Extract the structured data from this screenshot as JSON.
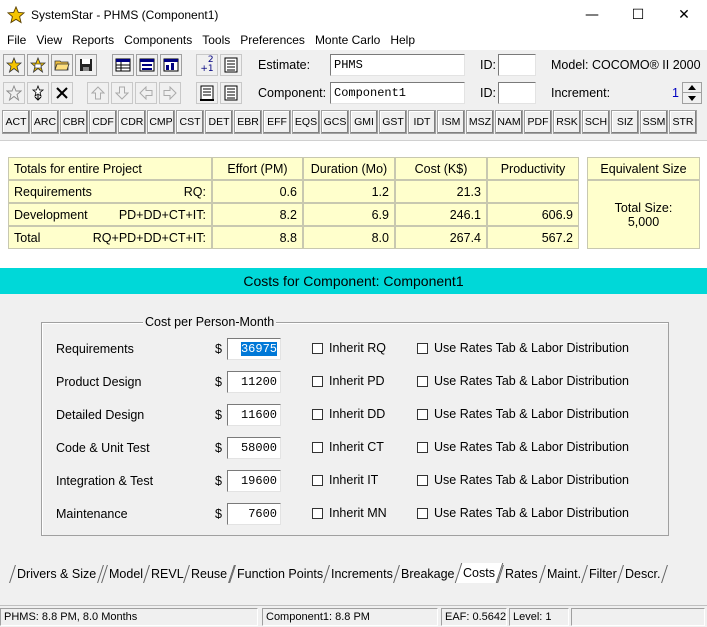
{
  "window": {
    "title": "SystemStar - PHMS (Component1)",
    "minimize": "—",
    "maximize": "☐",
    "close": "✕"
  },
  "menu": [
    "File",
    "View",
    "Reports",
    "Components",
    "Tools",
    "Preferences",
    "Monte Carlo",
    "Help"
  ],
  "toolbar": {
    "estimate_label": "Estimate:",
    "estimate_value": "PHMS",
    "id_label": "ID:",
    "id_value": "",
    "model": "Model: COCOMO® II 2000",
    "component_label": "Component:",
    "component_value": "Component1",
    "id2_label": "ID:",
    "id2_value": "",
    "increment_label": "Increment:",
    "increment_value": "1",
    "renumber_top": "2",
    "renumber_bottom": "+1"
  },
  "codes": [
    "ACT",
    "ARC",
    "CBR",
    "CDF",
    "CDR",
    "CMP",
    "CST",
    "DET",
    "EBR",
    "EFF",
    "EQS",
    "GCS",
    "GMI",
    "GST",
    "IDT",
    "ISM",
    "MSZ",
    "NAM",
    "PDF",
    "RSK",
    "SCH",
    "SIZ",
    "SSM",
    "STR"
  ],
  "summary": {
    "headers": [
      "Totals for entire Project",
      "Effort (PM)",
      "Duration (Mo)",
      "Cost (K$)",
      "Productivity"
    ],
    "rows": [
      {
        "name": "Requirements",
        "phases": "RQ:",
        "effort": "0.6",
        "duration": "1.2",
        "cost": "21.3",
        "productivity": ""
      },
      {
        "name": "Development",
        "phases": "PD+DD+CT+IT:",
        "effort": "8.2",
        "duration": "6.9",
        "cost": "246.1",
        "productivity": "606.9"
      },
      {
        "name": "Total",
        "phases": "RQ+PD+DD+CT+IT:",
        "effort": "8.8",
        "duration": "8.0",
        "cost": "267.4",
        "productivity": "567.2"
      }
    ],
    "equivalent_size_header": "Equivalent Size",
    "total_size_label": "Total Size:",
    "total_size_value": "5,000"
  },
  "banner": "Costs for Component: Component1",
  "costs": {
    "group_title": "Cost per Person-Month",
    "currency": "$",
    "rates_label": "Use Rates Tab & Labor Distribution",
    "rows": [
      {
        "label": "Requirements",
        "value": "36975",
        "inherit": "Inherit RQ"
      },
      {
        "label": "Product Design",
        "value": "11200",
        "inherit": "Inherit PD"
      },
      {
        "label": "Detailed Design",
        "value": "11600",
        "inherit": "Inherit DD"
      },
      {
        "label": "Code & Unit Test",
        "value": "58000",
        "inherit": "Inherit CT"
      },
      {
        "label": "Integration & Test",
        "value": "19600",
        "inherit": "Inherit IT"
      },
      {
        "label": "Maintenance",
        "value": "7600",
        "inherit": "Inherit MN"
      }
    ]
  },
  "tabs": [
    "Drivers & Size",
    "Model",
    "REVL",
    "Reuse",
    "Function Points",
    "Increments",
    "Breakage",
    "Costs",
    "Rates",
    "Maint.",
    "Filter",
    "Descr."
  ],
  "active_tab": "Costs",
  "status": {
    "project": "PHMS:  8.8 PM,  8.0 Months",
    "component": "Component1:  8.8 PM",
    "eaf": "EAF: 0.5642",
    "level": "Level:   1"
  }
}
